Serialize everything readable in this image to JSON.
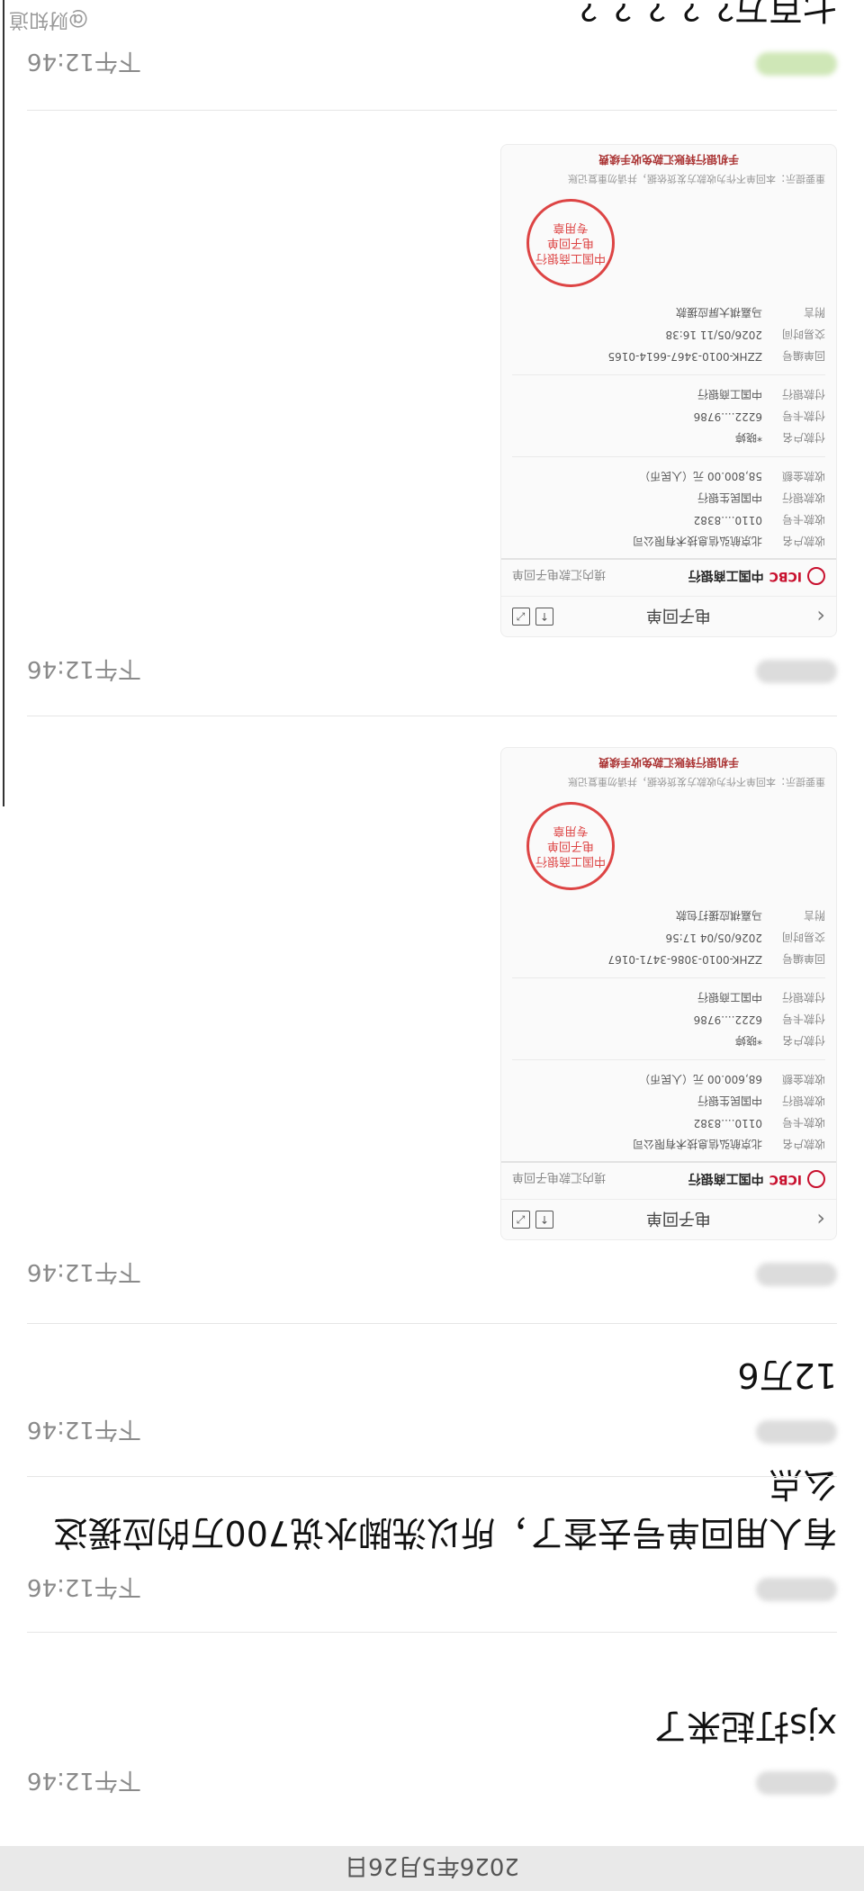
{
  "date_divider": "2026年5月26日",
  "watermark": "@财知道",
  "messages": [
    {
      "time": "下午12:46",
      "text": "xjs打起来了"
    },
    {
      "time": "下午12:46",
      "text": "有人用回单号去查了，所以洗脚水说700万的应援这么点"
    },
    {
      "time": "下午12:46",
      "text": "12万6"
    },
    {
      "time": "下午12:46",
      "receipt_index": 0
    },
    {
      "time": "下午12:46",
      "receipt_index": 1
    },
    {
      "time": "下午12:46",
      "text": "七百万？？？？？"
    }
  ],
  "receipts": [
    {
      "header_title": "电子回单",
      "bank_name": "中国工商银行",
      "bank_abbr": "ICBC",
      "doc_type": "境内汇款电子回单",
      "payee_name_label": "收款户名",
      "payee_name": "北京航弘信息技术有限公司",
      "payee_account_label": "收款卡号",
      "payee_account": "0110....8382",
      "payee_bank_label": "收款银行",
      "payee_bank": "中国民生银行",
      "amount_label": "收款金额",
      "amount": "68,600.00 元（人民币）",
      "payer_name_label": "付款户名",
      "payer_name": "*晓婷",
      "payer_account_label": "付款卡号",
      "payer_account": "6222....9786",
      "payer_bank_label": "付款银行",
      "payer_bank": "中国工商银行",
      "receipt_no_label": "回单编号",
      "receipt_no": "ZZHK-0010-3086-3471-0167",
      "time_label": "交易时间",
      "time": "2026/05/04 17:56",
      "note_label": "附言",
      "note": "马嘉祺应援打包款",
      "stamp_lines": [
        "中国工商银行",
        "电子回单",
        "专用章"
      ],
      "tip": "重要提示：本回单不作为收款方发货依据，并请勿重复记账",
      "footer": "手机银行转账汇款免收手续费"
    },
    {
      "header_title": "电子回单",
      "bank_name": "中国工商银行",
      "bank_abbr": "ICBC",
      "doc_type": "境内汇款电子回单",
      "payee_name_label": "收款户名",
      "payee_name": "北京航弘信息技术有限公司",
      "payee_account_label": "收款卡号",
      "payee_account": "0110....8382",
      "payee_bank_label": "收款银行",
      "payee_bank": "中国民生银行",
      "amount_label": "收款金额",
      "amount": "58,800.00 元（人民币）",
      "payer_name_label": "付款户名",
      "payer_name": "*晓婷",
      "payer_account_label": "付款卡号",
      "payer_account": "6222....9786",
      "payer_bank_label": "付款银行",
      "payer_bank": "中国工商银行",
      "receipt_no_label": "回单编号",
      "receipt_no": "ZZHK-0010-3467-6614-0165",
      "time_label": "交易时间",
      "time": "2026/05/11 16:38",
      "note_label": "附言",
      "note": "马嘉祺大屏应援款",
      "stamp_lines": [
        "中国工商银行",
        "电子回单",
        "专用章"
      ],
      "tip": "重要提示：本回单不作为收款方发货依据，并请勿重复记账",
      "footer": "手机银行转账汇款免收手续费"
    }
  ]
}
